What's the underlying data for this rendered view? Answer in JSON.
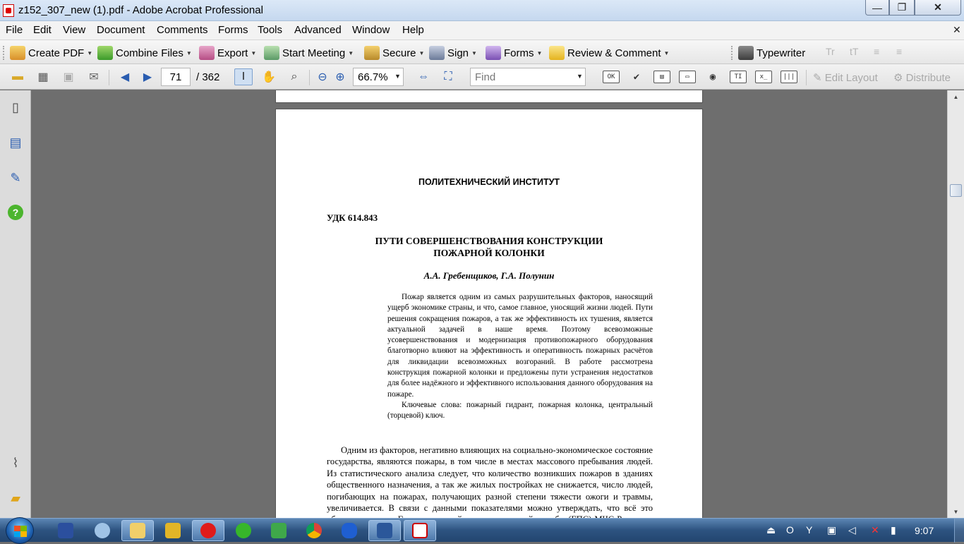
{
  "window": {
    "title": "z152_307_new (1).pdf - Adobe Acrobat Professional",
    "minimize_glyph": "—",
    "maximize_glyph": "❐",
    "close_glyph": "✕"
  },
  "menu": {
    "items": [
      "File",
      "Edit",
      "View",
      "Document",
      "Comments",
      "Forms",
      "Tools",
      "Advanced",
      "Window",
      "Help"
    ],
    "close_doc_glyph": "✕"
  },
  "tasks": {
    "create_pdf": "Create PDF",
    "combine_files": "Combine Files",
    "export": "Export",
    "start_meeting": "Start Meeting",
    "secure": "Secure",
    "sign": "Sign",
    "forms": "Forms",
    "review_comment": "Review & Comment",
    "typewriter": "Typewriter",
    "text_tools": [
      "Tr",
      "tT",
      "≡",
      "≡"
    ]
  },
  "toolbar": {
    "page_current": "71",
    "page_total": "/ 362",
    "zoom": "66.7%",
    "find_placeholder": "Find",
    "form_tools": [
      "OK",
      "✔",
      "▤",
      "▭",
      "◉",
      "TI",
      "x_",
      "|||"
    ],
    "edit_layout": "Edit Layout",
    "distribute": "Distribute"
  },
  "page": {
    "institute": "ПОЛИТЕХНИЧЕСКИЙ ИНСТИТУТ",
    "udk": "УДК 614.843",
    "title_line1": "ПУТИ СОВЕРШЕНСТВОВАНИЯ КОНСТРУКЦИИ",
    "title_line2": "ПОЖАРНОЙ КОЛОНКИ",
    "authors": "А.А. Гребенщиков, Г.А. Полунин",
    "abstract": "Пожар является одним из самых разрушительных факторов, наносящий ущерб экономике страны, и что, самое главное, уносящий жизни людей. Пути решения сокращения пожаров, а так же эффективность их тушения, является актуальной задачей в наше время. Поэтому всевозможные усовершенствования и модернизация противопожарного оборудования благотворно влияют на эффективность и оперативность пожарных расчётов для ликвидации всевозможных возгораний. В работе рассмотрена конструкция пожарной колонки и предложены пути устранения недостатков для более надёжного и эффективного использования данного оборудования на пожаре.",
    "keywords": "Ключевые слова: пожарный гидрант, пожарная колонка, центральный (торцевой) ключ.",
    "body": "Одним из факторов, негативно влияющих на социально-экономическое состояние государства, являются пожары, в том числе в местах массового пребывания людей. Из статистического анализа следует, что количество возникших пожаров в зданиях общественного назначения, а так же жилых постройках не снижается, число людей, погибающих на пожарах, получающих разной степени тяжести ожоги и травмы, увеличивается. В связи с данными показателями можно утверждать, что всё это обязывает органы Государственной противопожарной службы (ГПС) МЧС России, а также"
  },
  "taskbar": {
    "clock": "9:07",
    "tray_icons": [
      "usb-icon",
      "opera-icon",
      "yandex-icon",
      "network-adapter-icon",
      "volume-icon",
      "no-network-icon",
      "signal-icon"
    ]
  },
  "colors": {
    "accent": "#2a5db0",
    "taskbar": "#2d5380",
    "close_button": "#c7442a"
  }
}
